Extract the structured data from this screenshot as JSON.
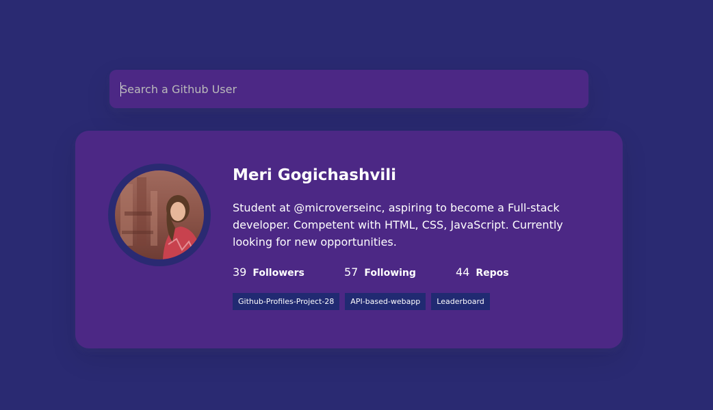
{
  "search": {
    "placeholder": "Search a Github User",
    "value": ""
  },
  "profile": {
    "avatar_icon": "user-avatar-photo",
    "name": "Meri Gogichashvili",
    "bio": "Student at @microverseinc, aspiring to become a Full-stack developer. Competent with HTML, CSS, JavaScript. Currently looking for new opportunities.",
    "stats": {
      "followers": {
        "count": "39",
        "label": "Followers"
      },
      "following": {
        "count": "57",
        "label": "Following"
      },
      "repos": {
        "count": "44",
        "label": "Repos"
      }
    },
    "repos": [
      {
        "name": "Github-Profiles-Project-28"
      },
      {
        "name": "API-based-webapp"
      },
      {
        "name": "Leaderboard"
      }
    ]
  },
  "colors": {
    "background": "#2a2a72",
    "card": "#4c2885",
    "repo_badge": "#212a72",
    "text": "#ffffff"
  }
}
